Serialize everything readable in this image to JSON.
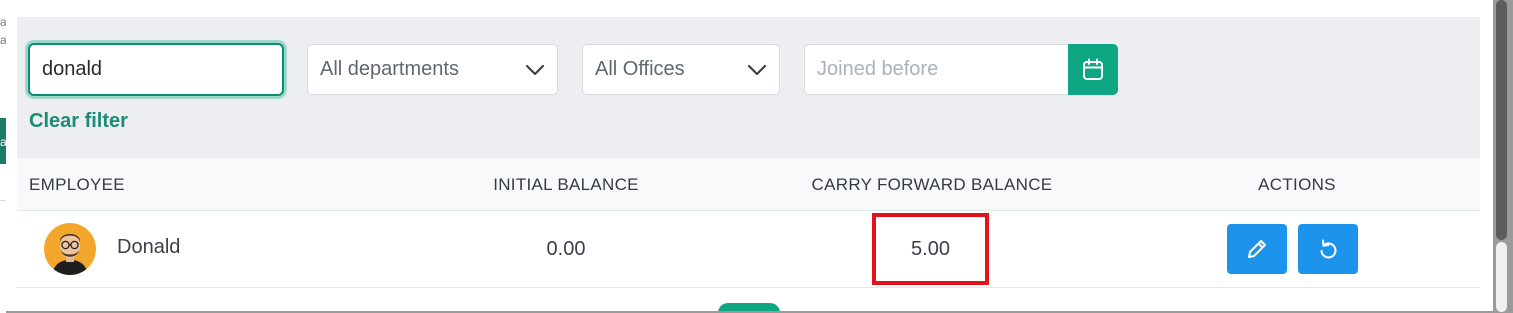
{
  "background": {
    "fragments": [
      "a",
      "a",
      "a"
    ]
  },
  "filters": {
    "search_value": "donald",
    "department_selected": "All departments",
    "office_selected": "All Offices",
    "date_placeholder": "Joined before",
    "clear_filter_label": "Clear filter"
  },
  "table": {
    "headers": {
      "employee": "EMPLOYEE",
      "initial_balance": "INITIAL BALANCE",
      "carry_forward_balance": "CARRY FORWARD BALANCE",
      "actions": "ACTIONS"
    },
    "rows": [
      {
        "name": "Donald",
        "initial_balance": "0.00",
        "carry_forward_balance": "5.00"
      }
    ]
  },
  "icons": {
    "calendar": "calendar-icon",
    "chevron": "chevron-down-icon",
    "edit": "pencil-icon",
    "reset": "undo-icon"
  },
  "colors": {
    "accent": "#0fa683",
    "action_blue": "#1c94ec",
    "highlight_red": "#e0141a"
  }
}
